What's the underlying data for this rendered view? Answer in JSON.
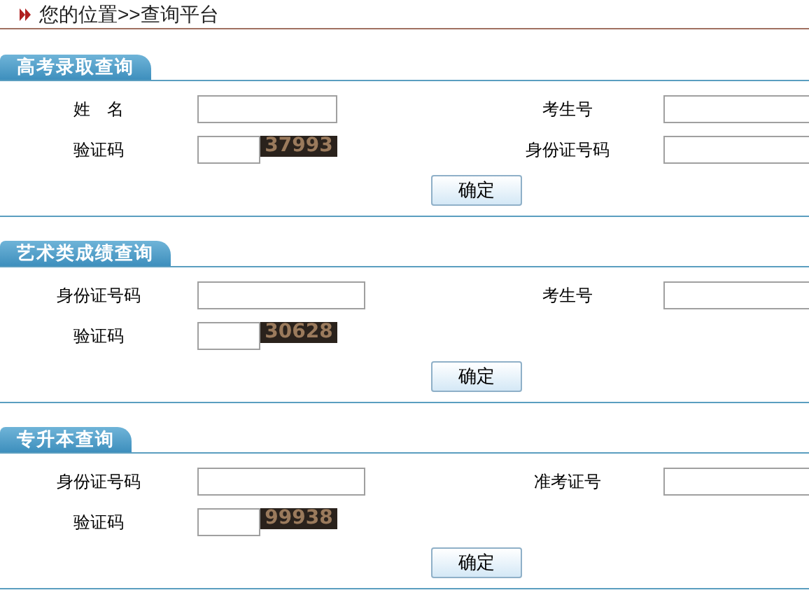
{
  "breadcrumb": "您的位置>>查询平台",
  "sections": [
    {
      "title": "高考录取查询",
      "rows": [
        [
          {
            "kind": "input",
            "label": "姓　名",
            "wide": false
          },
          {
            "kind": "input",
            "label": "考生号"
          }
        ],
        [
          {
            "kind": "captcha",
            "label": "验证码",
            "code": "37993"
          },
          {
            "kind": "input",
            "label": "身份证号码"
          }
        ]
      ],
      "submit": "确定"
    },
    {
      "title": "艺术类成绩查询",
      "rows": [
        [
          {
            "kind": "input",
            "label": "身份证号码",
            "wide": true
          },
          {
            "kind": "input",
            "label": "考生号"
          }
        ],
        [
          {
            "kind": "captcha",
            "label": "验证码",
            "code": "30628"
          }
        ]
      ],
      "submit": "确定"
    },
    {
      "title": "专升本查询",
      "rows": [
        [
          {
            "kind": "input",
            "label": "身份证号码",
            "wide": true
          },
          {
            "kind": "input",
            "label": "准考证号"
          }
        ],
        [
          {
            "kind": "captcha",
            "label": "验证码",
            "code": "99938"
          }
        ]
      ],
      "submit": "确定"
    }
  ]
}
